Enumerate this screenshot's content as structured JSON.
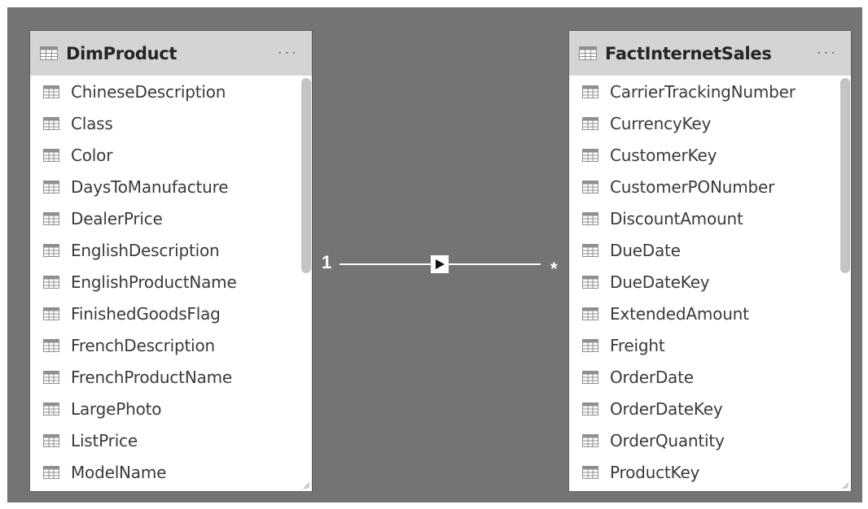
{
  "relationship": {
    "one_side": "1",
    "many_side": "*"
  },
  "tables": {
    "left": {
      "title": "DimProduct",
      "more_label": "···",
      "fields": [
        "ChineseDescription",
        "Class",
        "Color",
        "DaysToManufacture",
        "DealerPrice",
        "EnglishDescription",
        "EnglishProductName",
        "FinishedGoodsFlag",
        "FrenchDescription",
        "FrenchProductName",
        "LargePhoto",
        "ListPrice",
        "ModelName"
      ]
    },
    "right": {
      "title": "FactInternetSales",
      "more_label": "···",
      "fields": [
        "CarrierTrackingNumber",
        "CurrencyKey",
        "CustomerKey",
        "CustomerPONumber",
        "DiscountAmount",
        "DueDate",
        "DueDateKey",
        "ExtendedAmount",
        "Freight",
        "OrderDate",
        "OrderDateKey",
        "OrderQuantity",
        "ProductKey"
      ]
    }
  },
  "colors": {
    "canvas": "#747474",
    "header": "#d4d4d4",
    "icon": "#8f8f8f"
  }
}
